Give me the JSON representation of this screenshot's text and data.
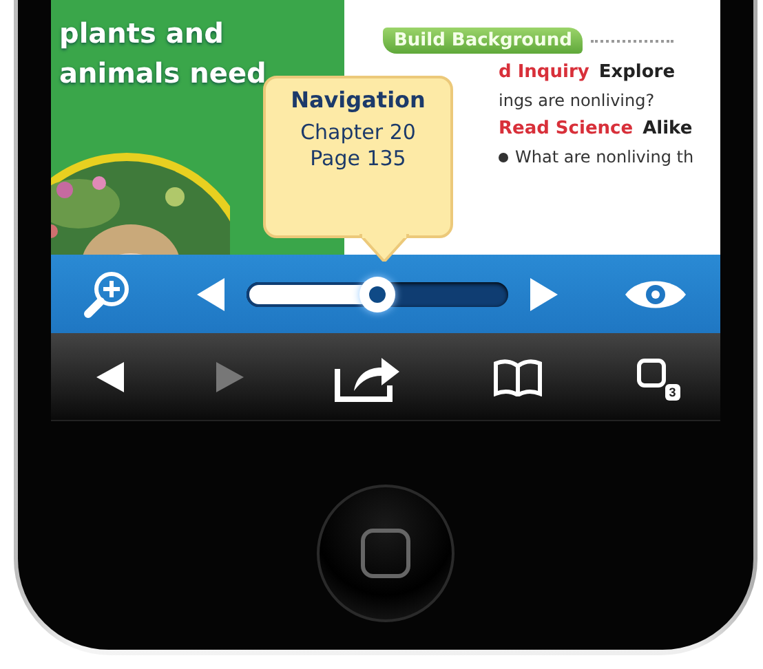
{
  "page": {
    "headline": [
      "plants and",
      "animals need"
    ],
    "banner": "Build Background",
    "lines": [
      {
        "kind": "heading",
        "label": "d Inquiry",
        "title": "Explore"
      },
      {
        "kind": "text",
        "text": "ings are nonliving?"
      },
      {
        "kind": "heading",
        "label": "Read Science",
        "title": "Alike"
      },
      {
        "kind": "bullet",
        "text": "What are nonliving th"
      }
    ]
  },
  "tooltip": {
    "title": "Navigation",
    "lines": [
      "Chapter 20",
      "Page 135"
    ]
  },
  "reader_bar": {
    "slider": {
      "level": 0.5
    }
  },
  "toolbar": {
    "items": [
      {
        "kind": "back",
        "disabled": false
      },
      {
        "kind": "forward",
        "disabled": true
      },
      {
        "kind": "share",
        "disabled": false
      },
      {
        "kind": "bookmarks",
        "disabled": false
      },
      {
        "kind": "tabs",
        "disabled": false,
        "count": "3"
      }
    ]
  }
}
